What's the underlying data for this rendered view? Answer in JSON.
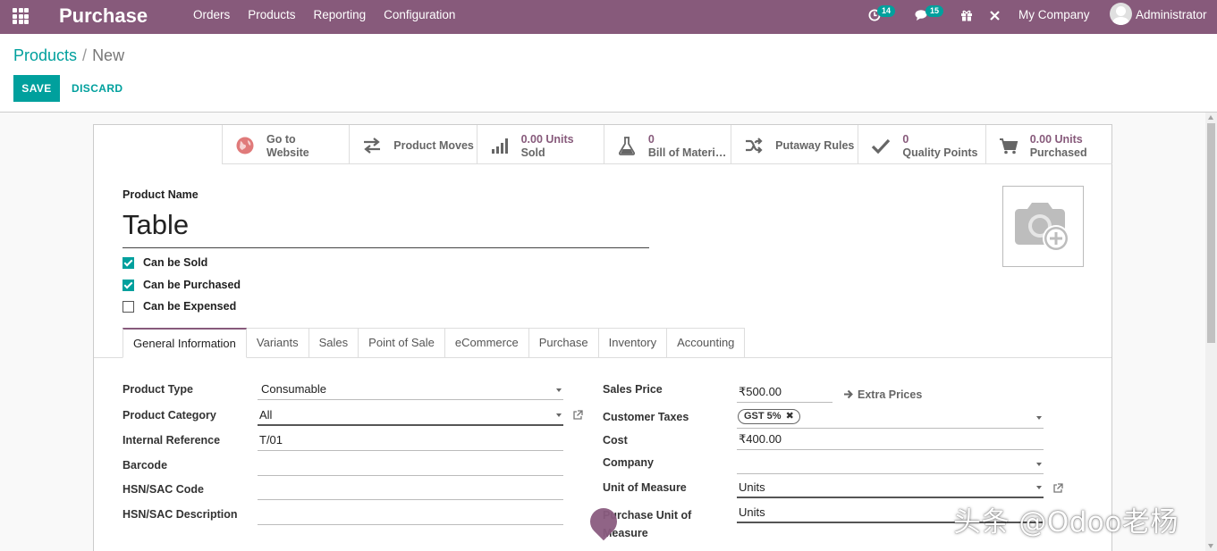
{
  "navbar": {
    "app_name": "Purchase",
    "menu": [
      "Orders",
      "Products",
      "Reporting",
      "Configuration"
    ],
    "activity_count": "14",
    "messages_count": "15",
    "company": "My Company",
    "user": "Administrator",
    "color": "#875a7b"
  },
  "breadcrumb": {
    "parent": "Products",
    "separator": "/",
    "current": "New"
  },
  "actions": {
    "save": "SAVE",
    "discard": "DISCARD"
  },
  "smart_buttons": [
    {
      "icon": "globe-icon",
      "line1": "Go to",
      "line2": "Website"
    },
    {
      "icon": "exchange-icon",
      "label": "Product Moves"
    },
    {
      "icon": "bar-chart-icon",
      "line1": "0.00 Units",
      "line2": "Sold"
    },
    {
      "icon": "flask-icon",
      "line1": "0",
      "line2": "Bill of Materi…"
    },
    {
      "icon": "shuffle-icon",
      "label": "Putaway Rules"
    },
    {
      "icon": "check-icon",
      "line1": "0",
      "line2": "Quality Points"
    },
    {
      "icon": "cart-icon",
      "line1": "0.00 Units",
      "line2": "Purchased"
    }
  ],
  "product": {
    "name_label": "Product Name",
    "name": "Table",
    "options": [
      {
        "label": "Can be Sold",
        "checked": true
      },
      {
        "label": "Can be Purchased",
        "checked": true
      },
      {
        "label": "Can be Expensed",
        "checked": false
      }
    ]
  },
  "tabs": [
    "General Information",
    "Variants",
    "Sales",
    "Point of Sale",
    "eCommerce",
    "Purchase",
    "Inventory",
    "Accounting"
  ],
  "active_tab": "General Information",
  "left_fields": {
    "product_type": {
      "label": "Product Type",
      "value": "Consumable"
    },
    "product_category": {
      "label": "Product Category",
      "value": "All"
    },
    "internal_reference": {
      "label": "Internal Reference",
      "value": "T/01"
    },
    "barcode": {
      "label": "Barcode",
      "value": ""
    },
    "hsn_code": {
      "label": "HSN/SAC Code",
      "value": ""
    },
    "hsn_description": {
      "label": "HSN/SAC Description",
      "value": ""
    }
  },
  "right_fields": {
    "sales_price": {
      "label": "Sales Price",
      "value": "₹500.00"
    },
    "extra_prices": "Extra Prices",
    "customer_taxes": {
      "label": "Customer Taxes",
      "tag": "GST 5%"
    },
    "cost": {
      "label": "Cost",
      "value": "₹400.00"
    },
    "company": {
      "label": "Company",
      "value": ""
    },
    "uom": {
      "label": "Unit of Measure",
      "value": "Units"
    },
    "purchase_uom": {
      "label_line1": "Purchase Unit of",
      "label_line2": "Measure",
      "value": "Units"
    }
  },
  "watermark": "头条 @Odoo老杨"
}
